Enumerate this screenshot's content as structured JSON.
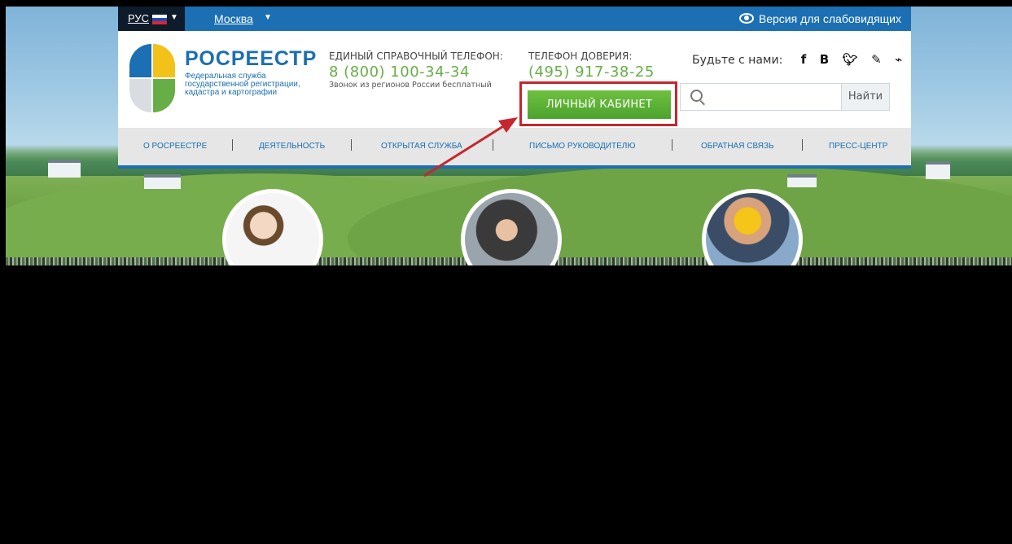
{
  "topbar": {
    "lang_label": "РУС",
    "city_label": "Москва",
    "accessible_label": "Версия для слабовидящих"
  },
  "logo": {
    "title": "РОСРЕЕСТР",
    "subtitle": "Федеральная служба государственной регистрации, кадастра и картографии"
  },
  "contacts": {
    "hotline_label": "ЕДИНЫЙ СПРАВОЧНЫЙ ТЕЛЕФОН:",
    "hotline_number": "8 (800) 100-34-34",
    "hotline_note": "Звонок из регионов России бесплатный",
    "trust_label": "ТЕЛЕФОН ДОВЕРИЯ:",
    "trust_number": "(495) 917-38-25"
  },
  "cabinet_button": "ЛИЧНЫЙ КАБИНЕТ",
  "social": {
    "label": "Будьте с нами:",
    "icons": [
      "facebook-icon",
      "vkontakte-icon",
      "twitter-icon",
      "livejournal-icon",
      "rss-icon"
    ]
  },
  "search": {
    "placeholder": "",
    "button_label": "Найти"
  },
  "nav": [
    "О РОСРЕЕСТРЕ",
    "ДЕЯТЕЛЬНОСТЬ",
    "ОТКРЫТАЯ СЛУЖБА",
    "ПИСЬМО РУКОВОДИТЕЛЮ",
    "ОБРАТНАЯ СВЯЗЬ",
    "ПРЕСС-ЦЕНТР"
  ],
  "colors": {
    "brand_blue": "#1b6fb2",
    "accent_green": "#68ae47",
    "highlight_red": "#c6262e"
  }
}
